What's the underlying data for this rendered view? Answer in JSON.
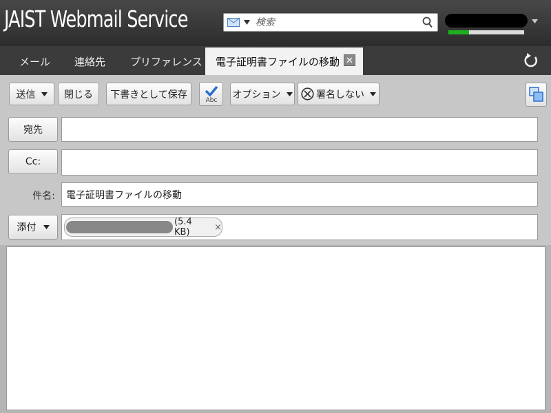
{
  "app": {
    "title": "JAIST Webmail Service"
  },
  "search": {
    "placeholder": "検索",
    "value": ""
  },
  "user": {
    "quota_fraction": 0.27,
    "quota_color": "#1db11d"
  },
  "tabs": [
    {
      "label": "メール"
    },
    {
      "label": "連絡先"
    },
    {
      "label": "プリファレンス"
    },
    {
      "label": "電子証明書ファイルの移動",
      "active": true,
      "close_glyph": "✕"
    }
  ],
  "toolbar": {
    "send_label": "送信",
    "close_label": "閉じる",
    "save_draft_label": "下書きとして保存",
    "spellcheck_text": "Abc",
    "options_label": "オプション",
    "sign_label": "署名しない"
  },
  "compose": {
    "to_label": "宛先",
    "to_value": "",
    "cc_label": "Cc:",
    "cc_value": "",
    "subject_label": "件名:",
    "subject_value": "電子証明書ファイルの移動",
    "attach_label": "添付",
    "attachment": {
      "size": "(5.4 KB)",
      "remove_glyph": "×"
    },
    "body_value": ""
  }
}
